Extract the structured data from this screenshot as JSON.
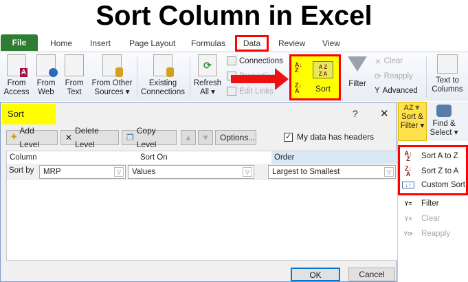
{
  "page_title": "Sort Column in Excel",
  "tabs": [
    "File",
    "Home",
    "Insert",
    "Page Layout",
    "Formulas",
    "Data",
    "Review",
    "View"
  ],
  "ribbon": {
    "from_access": "From Access",
    "from_web": "From Web",
    "from_text": "From Text",
    "from_other": "From Other Sources ▾",
    "existing": "Existing Connections",
    "refresh": "Refresh All ▾",
    "connections": "Connections",
    "properties": "Properties",
    "edit_links": "Edit Links",
    "sort": "Sort",
    "filter": "Filter",
    "clear": "Clear",
    "reapply": "Reapply",
    "advanced": "Advanced",
    "text_to_columns": "Text to Columns",
    "sort_filter": "Sort & Filter ▾",
    "find_select": "Find & Select ▾"
  },
  "dialog": {
    "title": "Sort",
    "help": "?",
    "close": "✕",
    "add_level": "Add Level",
    "delete_level": "Delete Level",
    "copy_level": "Copy Level",
    "options": "Options...",
    "headers_label": "My data has headers",
    "headers_checked": true,
    "col_header": "Column",
    "sorton_header": "Sort On",
    "order_header": "Order",
    "row_label": "Sort by",
    "column_value": "MRP",
    "sorton_value": "Values",
    "order_value": "Largest to Smallest",
    "ok": "OK",
    "cancel": "Cancel"
  },
  "menu": {
    "sort_az": "Sort A to Z",
    "sort_za": "Sort Z to A",
    "custom_sort": "Custom Sort",
    "filter": "Filter",
    "clear": "Clear",
    "reapply": "Reapply"
  }
}
